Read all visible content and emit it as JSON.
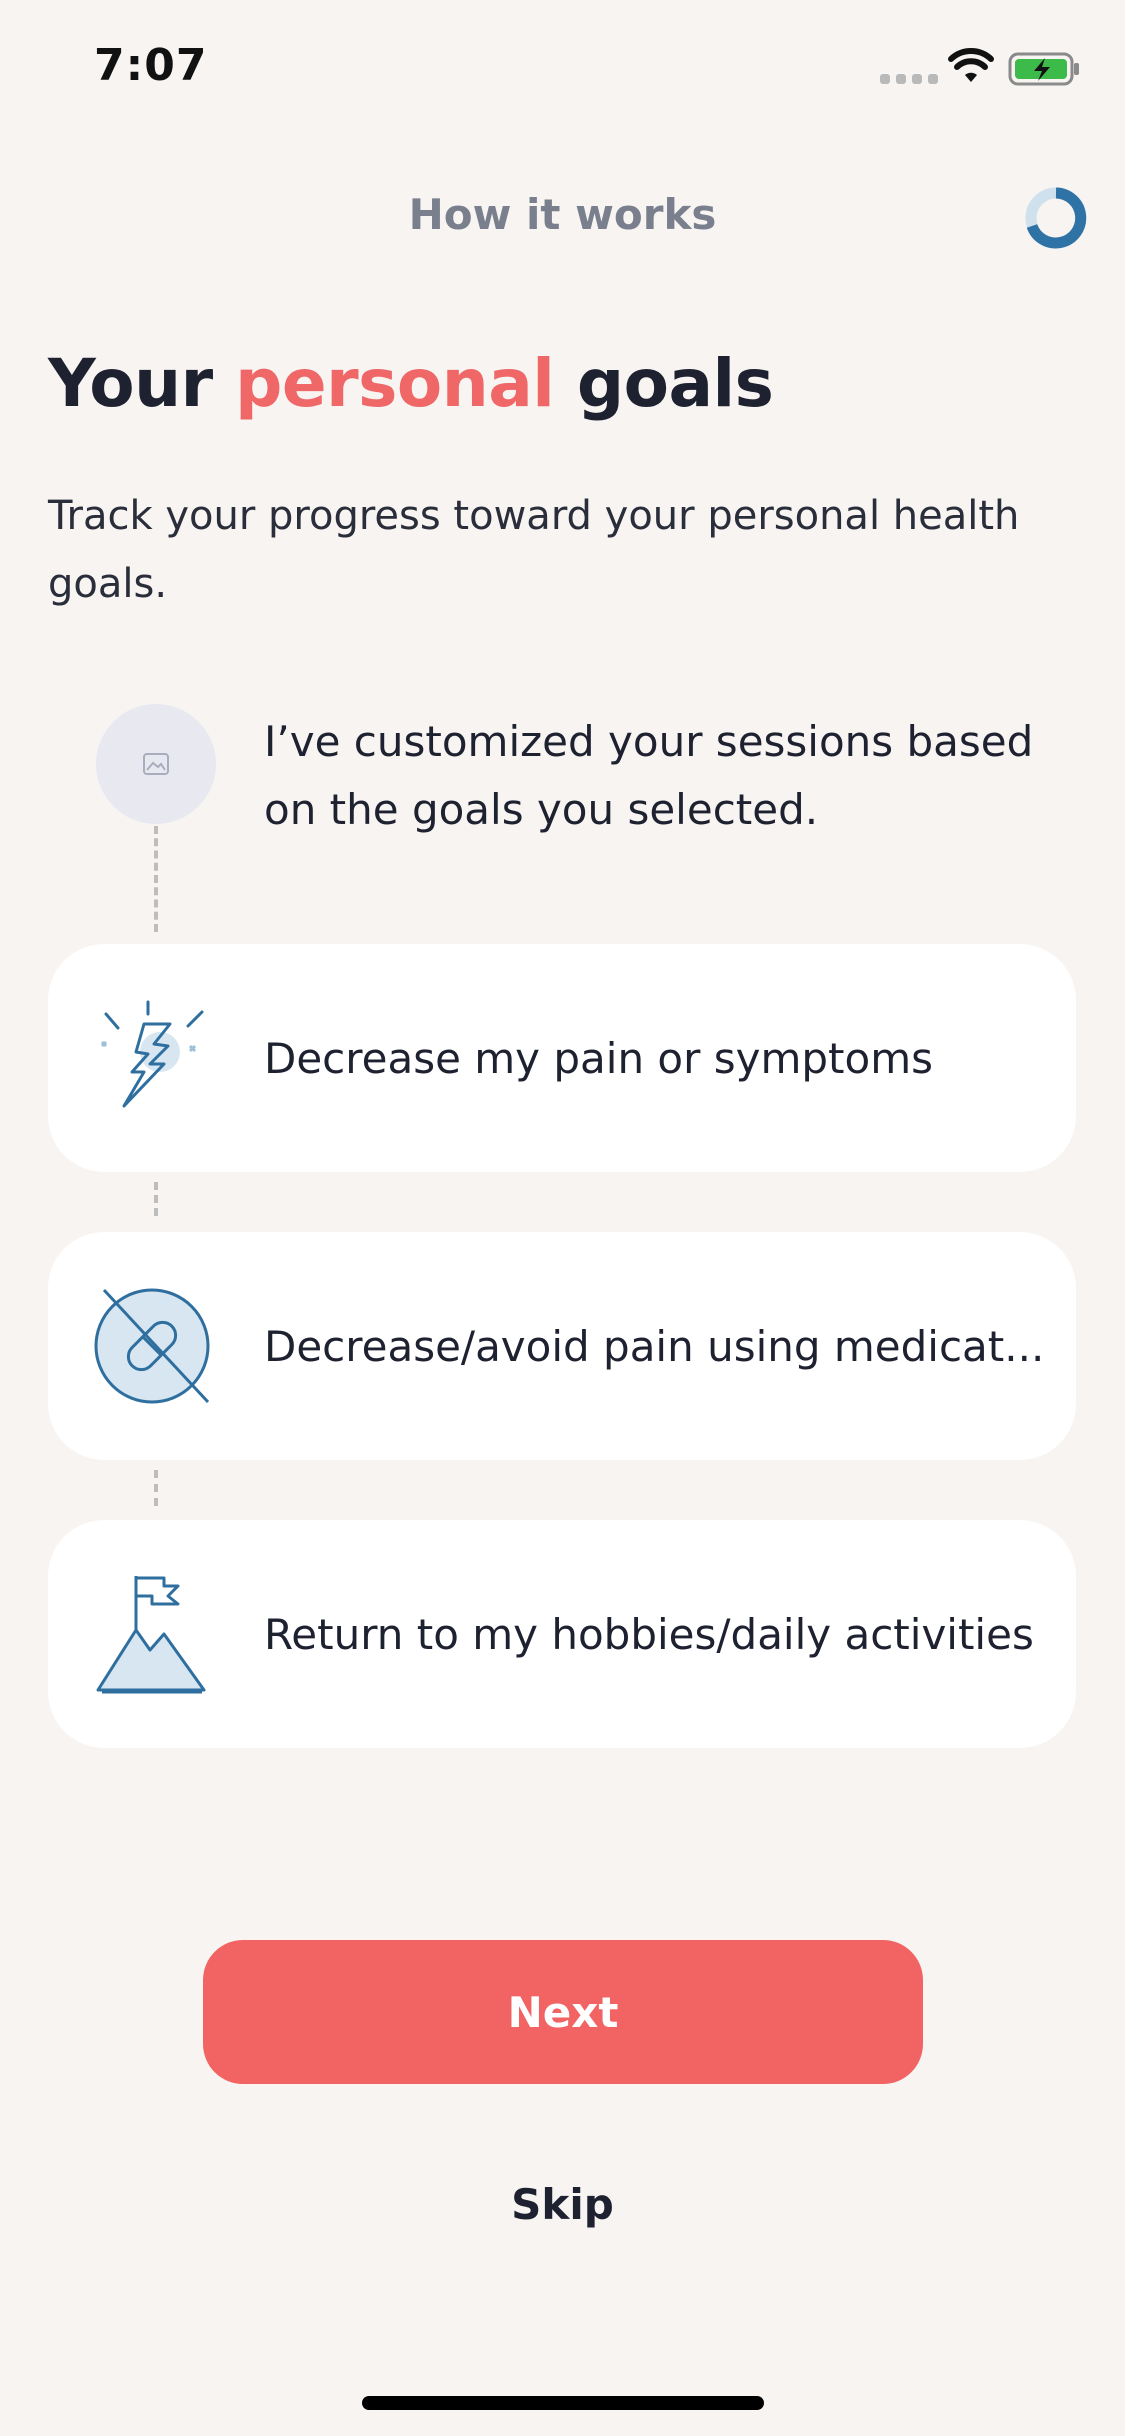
{
  "status_bar": {
    "time": "7:07"
  },
  "header": {
    "title": "How it works"
  },
  "headline": {
    "part1": "Your ",
    "accent": "personal",
    "part2": " goals"
  },
  "subtitle": "Track your progress toward your personal health goals.",
  "coach": {
    "message": "I’ve customized your sessions based on the goals you selected."
  },
  "goals": [
    {
      "label": "Decrease my pain or symptoms",
      "icon": "lightning-pain-icon"
    },
    {
      "label": "Decrease/avoid pain using medicat...",
      "icon": "no-medication-icon"
    },
    {
      "label": "Return to my hobbies/daily activities",
      "icon": "mountain-flag-icon"
    }
  ],
  "actions": {
    "next_label": "Next",
    "skip_label": "Skip"
  },
  "colors": {
    "accent": "#ef6767",
    "button": "#f26363",
    "icon_blue": "#2f6f9f",
    "background": "#f7f4f1"
  }
}
